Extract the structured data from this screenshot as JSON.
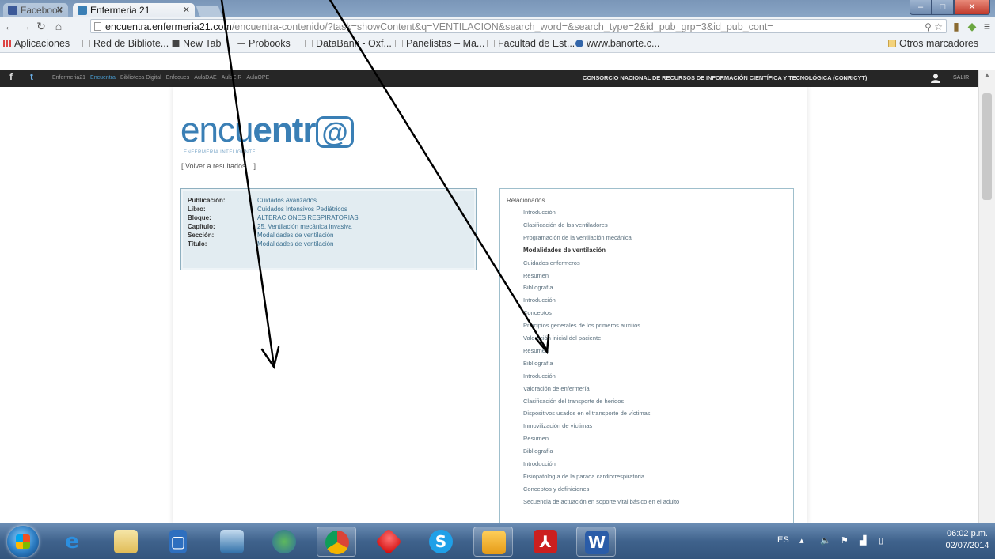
{
  "browser": {
    "tabs": [
      {
        "label": "Facebook",
        "active": false
      },
      {
        "label": "Enfermeria 21",
        "active": true
      }
    ],
    "url_host": "encuentra.enfermeria21.com",
    "url_path": "/encuentra-contenido/?task=showContent&q=VENTILACION&search_word=&search_type=2&id_pub_grp=3&id_pub_cont=",
    "bookmarks": [
      "Aplicaciones",
      "Red de Bibliote...",
      "New Tab",
      "Probooks",
      "DataBank - Oxf...",
      "Panelistas – Ma...",
      "Facultad de Est...",
      "www.banorte.c..."
    ],
    "other_bookmarks": "Otros marcadores"
  },
  "site": {
    "social": [
      "f",
      "t"
    ],
    "nav_links": [
      "Enfermeria21",
      "Encuentra",
      "Biblioteca Digital",
      "Enfoques",
      "AulaDAE",
      "AulaEIR",
      "AulaOPE"
    ],
    "consortium": "CONSORCIO NACIONAL DE RECURSOS DE INFORMACIÓN CIENTÍFICA Y TECNOLÓGICA (CONRICYT)",
    "logout": "SALIR",
    "logo_plain": "encu",
    "logo_bold": "entr",
    "logo_at": "@",
    "logo_sub": "ENFERMERÍA INTELIGENTE",
    "back_link": "[ Volver a resultados... ]"
  },
  "publication": {
    "rows": [
      {
        "label": "Publicación:",
        "value": "Cuidados Avanzados"
      },
      {
        "label": "Libro:",
        "value": "Cuidados Intensivos Pediátricos"
      },
      {
        "label": "Bloque:",
        "value": "ALTERACIONES RESPIRATORIAS"
      },
      {
        "label": "Capítulo:",
        "value": "25. Ventilación mecánica invasiva"
      },
      {
        "label": "Sección:",
        "value": "Modalidades de ventilación"
      },
      {
        "label": "Título:",
        "value": "Modalidades de ventilación"
      }
    ]
  },
  "related": {
    "title": "Relacionados",
    "items": [
      {
        "label": "Introducción",
        "bold": false
      },
      {
        "label": "Clasificación de los ventiladores",
        "bold": false
      },
      {
        "label": "Programación de la ventilación mecánica",
        "bold": false
      },
      {
        "label": "Modalidades de ventilación",
        "bold": true
      },
      {
        "label": "Cuidados enfermeros",
        "bold": false
      },
      {
        "label": "Resumen",
        "bold": false
      },
      {
        "label": "Bibliografía",
        "bold": false
      },
      {
        "label": "Introducción",
        "bold": false
      },
      {
        "label": "Conceptos",
        "bold": false
      },
      {
        "label": "Principios generales de los primeros auxilios",
        "bold": false
      },
      {
        "label": "Valoración inicial del paciente",
        "bold": false
      },
      {
        "label": "Resumen",
        "bold": false
      },
      {
        "label": "Bibliografía",
        "bold": false
      },
      {
        "label": "Introducción",
        "bold": false
      },
      {
        "label": "Valoración de enfermería",
        "bold": false
      },
      {
        "label": "Clasificación del transporte de heridos",
        "bold": false
      },
      {
        "label": "Dispositivos usados en el transporte de víctimas",
        "bold": false
      },
      {
        "label": "Inmovilización de víctimas",
        "bold": false
      },
      {
        "label": "Resumen",
        "bold": false
      },
      {
        "label": "Bibliografía",
        "bold": false
      },
      {
        "label": "Introducción",
        "bold": false
      },
      {
        "label": "Fisiopatología de la parada cardiorrespiratoria",
        "bold": false
      },
      {
        "label": "Conceptos y definiciones",
        "bold": false
      },
      {
        "label": "Secuencia de actuación en soporte vital básico en el adulto",
        "bold": false
      }
    ]
  },
  "taskbar": {
    "apps": [
      "windows-explorer",
      "internet-explorer",
      "file-explorer",
      "outlook",
      "weather",
      "network",
      "chrome",
      "security",
      "skype",
      "office",
      "acrobat",
      "word"
    ],
    "language": "ES",
    "time": "06:02 p.m.",
    "date": "02/07/2014"
  },
  "colors": {
    "brand_blue": "#3a7fb5",
    "info_box_bg": "#e2ecf1",
    "site_bar": "#262626"
  }
}
